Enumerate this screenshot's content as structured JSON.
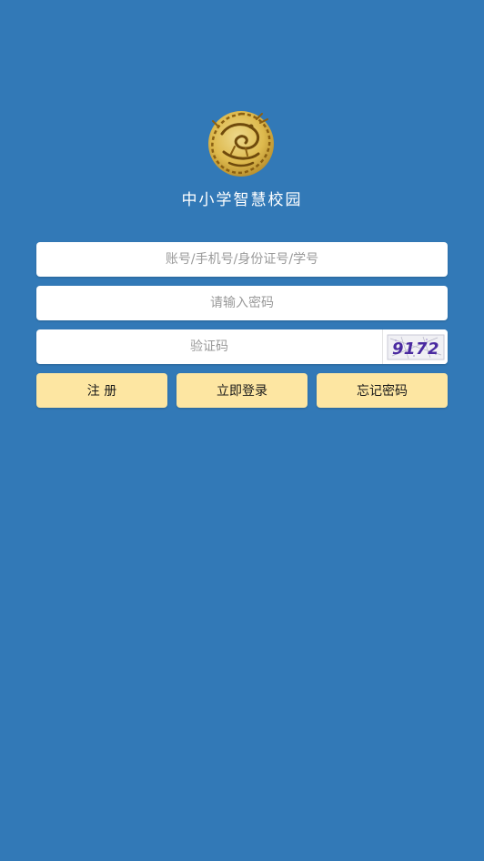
{
  "app": {
    "title": "中小学智慧校园",
    "logo_icon": "golden-dragon-emblem"
  },
  "form": {
    "account_placeholder": "账号/手机号/身份证号/学号",
    "password_placeholder": "请输入密码",
    "captcha_placeholder": "验证码",
    "captcha_text": "9172"
  },
  "buttons": {
    "register": "注 册",
    "login": "立即登录",
    "forgot": "忘记密码"
  },
  "colors": {
    "background": "#3279b7",
    "button": "#fde6a2",
    "logo_gold": "#e7bd48"
  }
}
